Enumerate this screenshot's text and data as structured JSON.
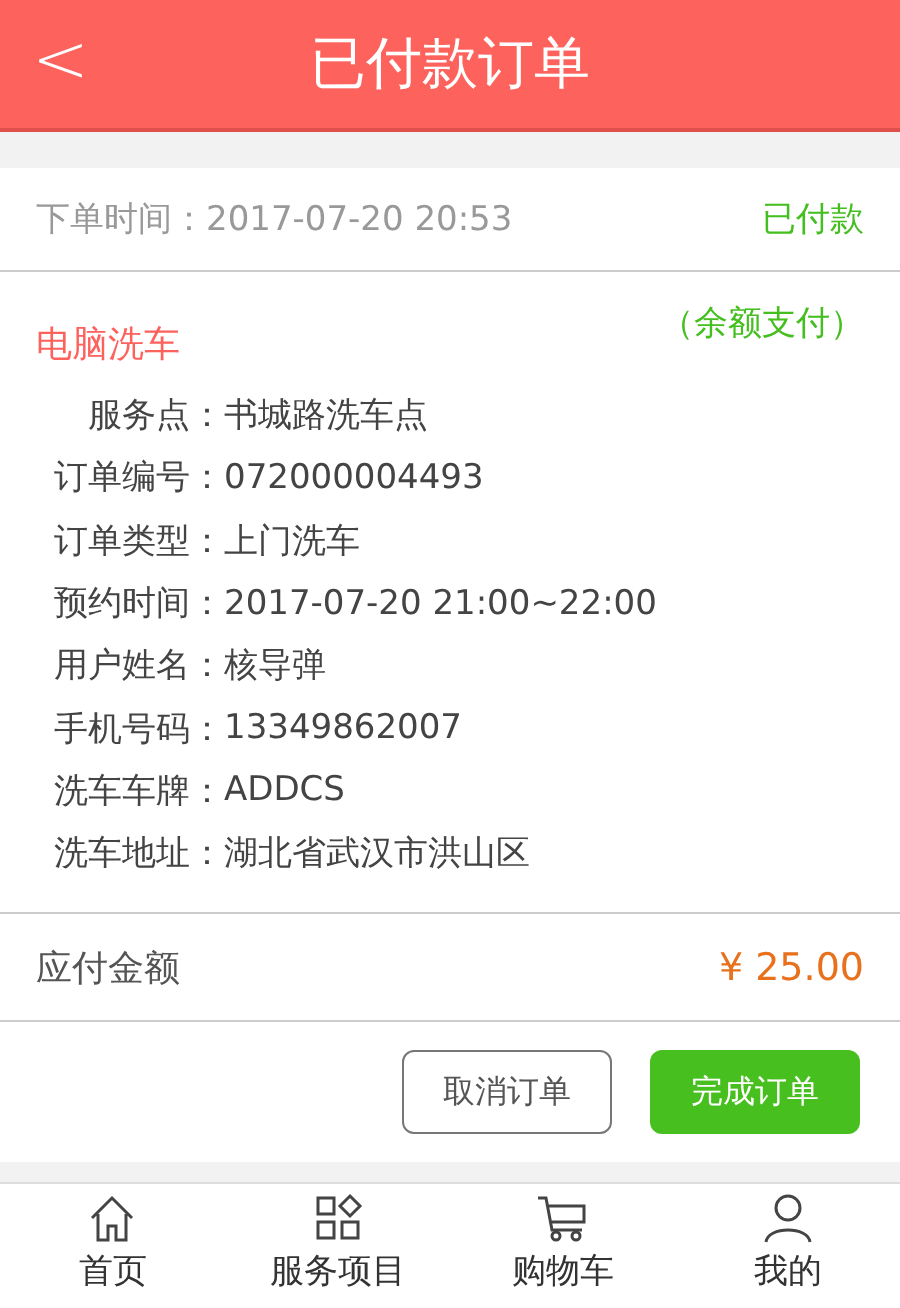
{
  "header": {
    "back": "<",
    "title": "已付款订单"
  },
  "order": {
    "time_label": "下单时间：",
    "time": "2017-07-20 20:53",
    "status": "已付款",
    "service": "电脑洗车",
    "payment": "（余额支付）",
    "details": [
      {
        "label": "服务点：",
        "value": "书城路洗车点"
      },
      {
        "label": "订单编号：",
        "value": "072000004493"
      },
      {
        "label": "订单类型：",
        "value": "上门洗车"
      },
      {
        "label": "预约时间：",
        "value": "2017-07-20 21:00~22:00"
      },
      {
        "label": "用户姓名：",
        "value": "核导弹"
      },
      {
        "label": "手机号码：",
        "value": "13349862007"
      },
      {
        "label": "洗车车牌：",
        "value": "ADDCS"
      },
      {
        "label": "洗车地址：",
        "value": "湖北省武汉市洪山区"
      }
    ],
    "amount_label": "应付金额",
    "amount": "¥ 25.00",
    "buttons": [
      {
        "label": "取消订单",
        "kind": "outline"
      },
      {
        "label": "完成订单",
        "kind": "primary"
      }
    ]
  },
  "tabbar": [
    {
      "label": "首页",
      "kind": "home"
    },
    {
      "label": "服务项目",
      "kind": "grid"
    },
    {
      "label": "购物车",
      "kind": "cart"
    },
    {
      "label": "我的",
      "kind": "user"
    }
  ]
}
